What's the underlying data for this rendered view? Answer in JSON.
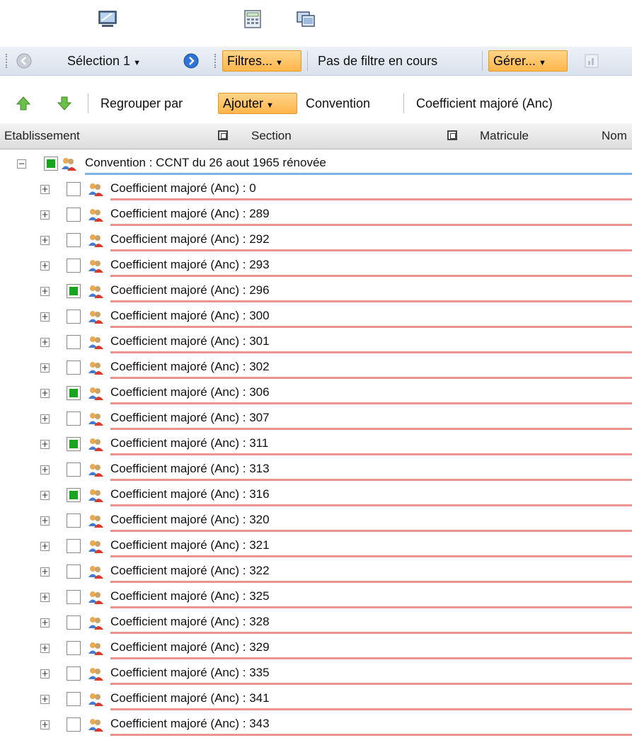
{
  "top_icons": [
    "monitor-icon",
    "calculator-icon",
    "windows-icon"
  ],
  "toolbar": {
    "selection_label": "Sélection 1",
    "filters_label": "Filtres...",
    "filter_status": "Pas de filtre en cours",
    "manage_label": "Gérer...",
    "group_by_label": "Regrouper par",
    "add_label": "Ajouter",
    "group_convention": "Convention",
    "group_coefficient": "Coefficient majoré (Anc)"
  },
  "columns": {
    "etablissement": "Etablissement",
    "section": "Section",
    "matricule": "Matricule",
    "nom": "Nom"
  },
  "tree": {
    "root_label": "Convention : CCNT du 26 aout 1965 rénovée",
    "root_checked": true,
    "items": [
      {
        "label": "Coefficient majoré (Anc) : 0",
        "checked": false
      },
      {
        "label": "Coefficient majoré (Anc) : 289",
        "checked": false
      },
      {
        "label": "Coefficient majoré (Anc) : 292",
        "checked": false
      },
      {
        "label": "Coefficient majoré (Anc) : 293",
        "checked": false
      },
      {
        "label": "Coefficient majoré (Anc) : 296",
        "checked": true
      },
      {
        "label": "Coefficient majoré (Anc) : 300",
        "checked": false
      },
      {
        "label": "Coefficient majoré (Anc) : 301",
        "checked": false
      },
      {
        "label": "Coefficient majoré (Anc) : 302",
        "checked": false
      },
      {
        "label": "Coefficient majoré (Anc) : 306",
        "checked": true
      },
      {
        "label": "Coefficient majoré (Anc) : 307",
        "checked": false
      },
      {
        "label": "Coefficient majoré (Anc) : 311",
        "checked": true
      },
      {
        "label": "Coefficient majoré (Anc) : 313",
        "checked": false
      },
      {
        "label": "Coefficient majoré (Anc) : 316",
        "checked": true
      },
      {
        "label": "Coefficient majoré (Anc) : 320",
        "checked": false
      },
      {
        "label": "Coefficient majoré (Anc) : 321",
        "checked": false
      },
      {
        "label": "Coefficient majoré (Anc) : 322",
        "checked": false
      },
      {
        "label": "Coefficient majoré (Anc) : 325",
        "checked": false
      },
      {
        "label": "Coefficient majoré (Anc) : 328",
        "checked": false
      },
      {
        "label": "Coefficient majoré (Anc) : 329",
        "checked": false
      },
      {
        "label": "Coefficient majoré (Anc) : 335",
        "checked": false
      },
      {
        "label": "Coefficient majoré (Anc) : 341",
        "checked": false
      },
      {
        "label": "Coefficient majoré (Anc) : 343",
        "checked": false
      }
    ]
  },
  "colors": {
    "accent_orange": "#ffb54a",
    "check_green": "#17a41f",
    "root_underline": "#7fb2e6",
    "item_underline": "#e8948e"
  }
}
